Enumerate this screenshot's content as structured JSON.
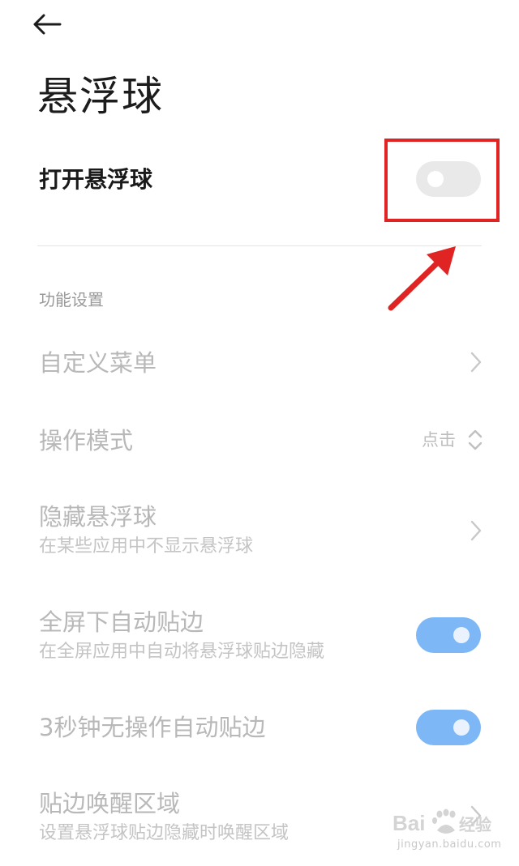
{
  "header": {
    "back_icon": "arrow-left-icon",
    "title": "悬浮球"
  },
  "master": {
    "label": "打开悬浮球",
    "enabled": false,
    "highlight_color": "#e02424"
  },
  "section": {
    "header": "功能设置"
  },
  "rows": [
    {
      "title": "自定义菜单",
      "type": "link"
    },
    {
      "title": "操作模式",
      "type": "select",
      "value": "点击"
    },
    {
      "title": "隐藏悬浮球",
      "subtitle": "在某些应用中不显示悬浮球",
      "type": "link"
    },
    {
      "title": "全屏下自动贴边",
      "subtitle": "在全屏应用中自动将悬浮球贴边隐藏",
      "type": "switch",
      "enabled": true
    },
    {
      "title": "3秒钟无操作自动贴边",
      "type": "switch",
      "enabled": true
    },
    {
      "title": "贴边唤醒区域",
      "subtitle": "设置悬浮球贴边隐藏时唤醒区域",
      "type": "link"
    }
  ],
  "watermark": {
    "logo": "Bai经验",
    "url": "jingyan.baidu.com"
  },
  "colors": {
    "switch_on": "#7db7f6",
    "switch_off": "#e9e9e9",
    "annotation_red": "#e02424"
  }
}
